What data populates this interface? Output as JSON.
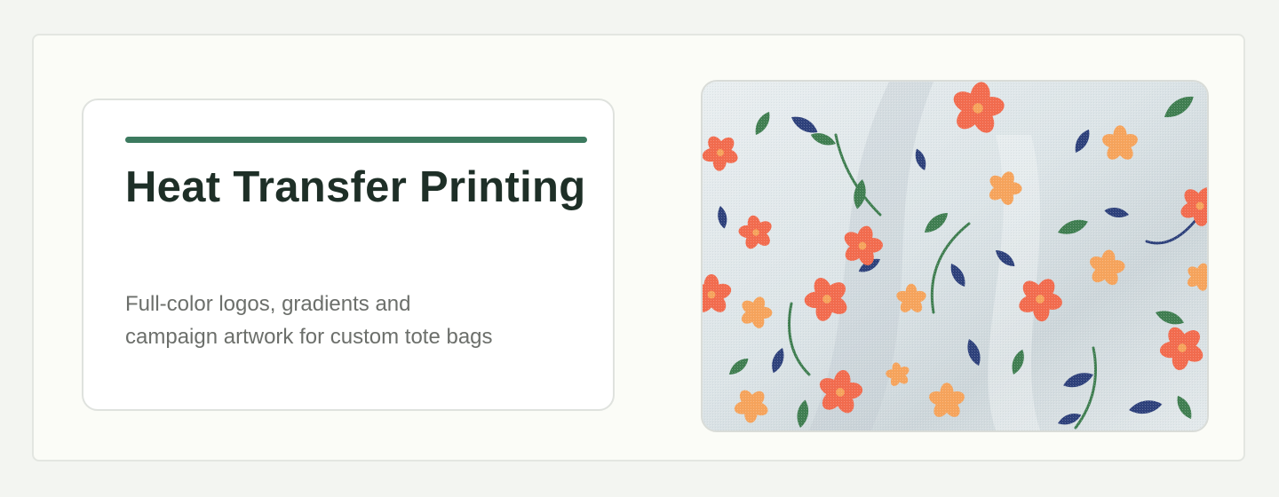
{
  "card": {
    "title": "Heat Transfer Printing",
    "description": "Full-color logos, gradients and\ncampaign artwork for custom tote bags"
  },
  "colors": {
    "accent": "#3c7a5f",
    "title_text": "#1e2f27",
    "body_text": "#6c6f6b",
    "fabric_base": "#dfe6e8",
    "flower_coral": "#f36a4c",
    "flower_peach": "#f7a35a",
    "leaf_green": "#3e7d4f",
    "leaf_navy": "#2c3f7a"
  },
  "image": {
    "subject": "floral-printed-fabric"
  }
}
